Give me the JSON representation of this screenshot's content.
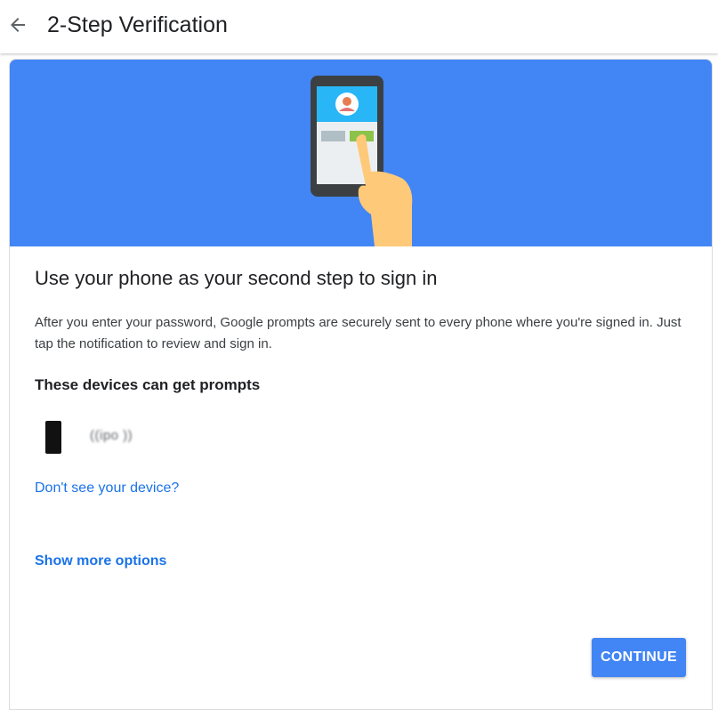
{
  "header": {
    "back_icon": "arrow-back-icon",
    "title": "2-Step Verification"
  },
  "hero": {
    "background_color": "#4285f4",
    "illustration": "phone-tap-illustration"
  },
  "main": {
    "heading": "Use your phone as your second step to sign in",
    "description": "After you enter your password, Google prompts are securely sent to every phone where you're signed in. Just tap the notification to review and sign in.",
    "devices_heading": "These devices can get prompts",
    "devices": [
      {
        "icon": "phone-icon",
        "name": "((ipo ))"
      }
    ],
    "missing_device_link": "Don't see your device?",
    "more_options_link": "Show more options",
    "continue_label": "CONTINUE"
  },
  "colors": {
    "accent": "#4285f4",
    "link": "#1a73e8",
    "text": "#202124"
  }
}
